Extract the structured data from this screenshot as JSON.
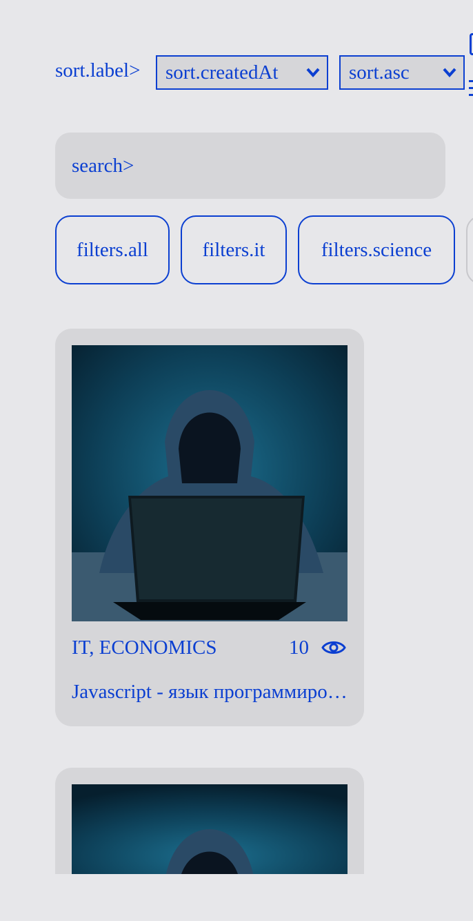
{
  "sort": {
    "label": "sort.label>",
    "field_value": "sort.createdAt",
    "order_value": "sort.asc"
  },
  "search": {
    "placeholder": "search>"
  },
  "filters": [
    "filters.all",
    "filters.it",
    "filters.science"
  ],
  "articles": [
    {
      "types": "IT, ECONOMICS",
      "views": "10",
      "title": "Javascript - язык программирования"
    }
  ],
  "colors": {
    "accent": "#0b3fd1",
    "background": "#e7e7ea",
    "surface": "#d6d6d9"
  }
}
